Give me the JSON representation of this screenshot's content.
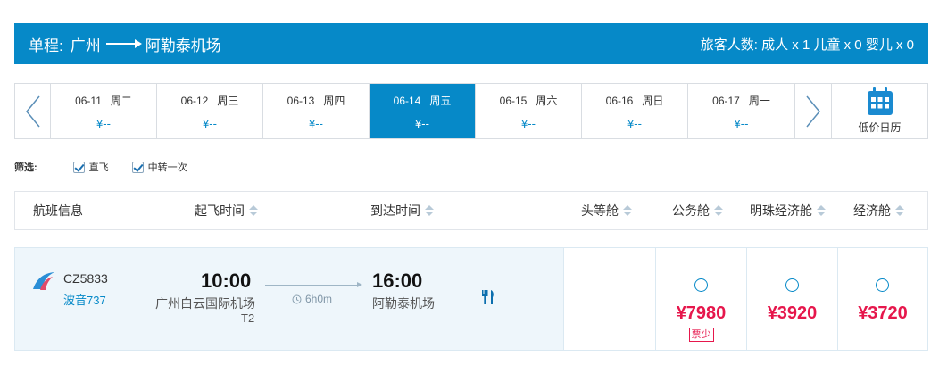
{
  "route": {
    "trip_type": "单程:",
    "origin": "广州",
    "destination": "阿勒泰机场",
    "passengers": "旅客人数: 成人 x 1 儿童 x 0 婴儿 x 0"
  },
  "dates": [
    {
      "date": "06-11",
      "weekday": "周二",
      "price": "¥--",
      "active": false
    },
    {
      "date": "06-12",
      "weekday": "周三",
      "price": "¥--",
      "active": false
    },
    {
      "date": "06-13",
      "weekday": "周四",
      "price": "¥--",
      "active": false
    },
    {
      "date": "06-14",
      "weekday": "周五",
      "price": "¥--",
      "active": true
    },
    {
      "date": "06-15",
      "weekday": "周六",
      "price": "¥--",
      "active": false
    },
    {
      "date": "06-16",
      "weekday": "周日",
      "price": "¥--",
      "active": false
    },
    {
      "date": "06-17",
      "weekday": "周一",
      "price": "¥--",
      "active": false
    }
  ],
  "calendar_label": "低价日历",
  "filter": {
    "label": "筛选:",
    "options": [
      {
        "label": "直飞",
        "checked": true
      },
      {
        "label": "中转一次",
        "checked": true
      }
    ]
  },
  "headers": {
    "flight_info": "航班信息",
    "departure_time": "起飞时间",
    "arrival_time": "到达时间",
    "first_class": "头等舱",
    "business_class": "公务舱",
    "pearl_economy": "明珠经济舱",
    "economy": "经济舱"
  },
  "flight": {
    "number": "CZ5833",
    "aircraft": "波音737",
    "dep_time": "10:00",
    "dep_airport": "广州白云国际机场",
    "terminal": "T2",
    "duration": "6h0m",
    "arr_time": "16:00",
    "arr_airport": "阿勒泰机场",
    "business_price": "¥7980",
    "business_tag": "票少",
    "pearl_price": "¥3920",
    "economy_price": "¥3720"
  },
  "colors": {
    "brand_blue": "#0689c8",
    "price_red": "#e6174c"
  }
}
